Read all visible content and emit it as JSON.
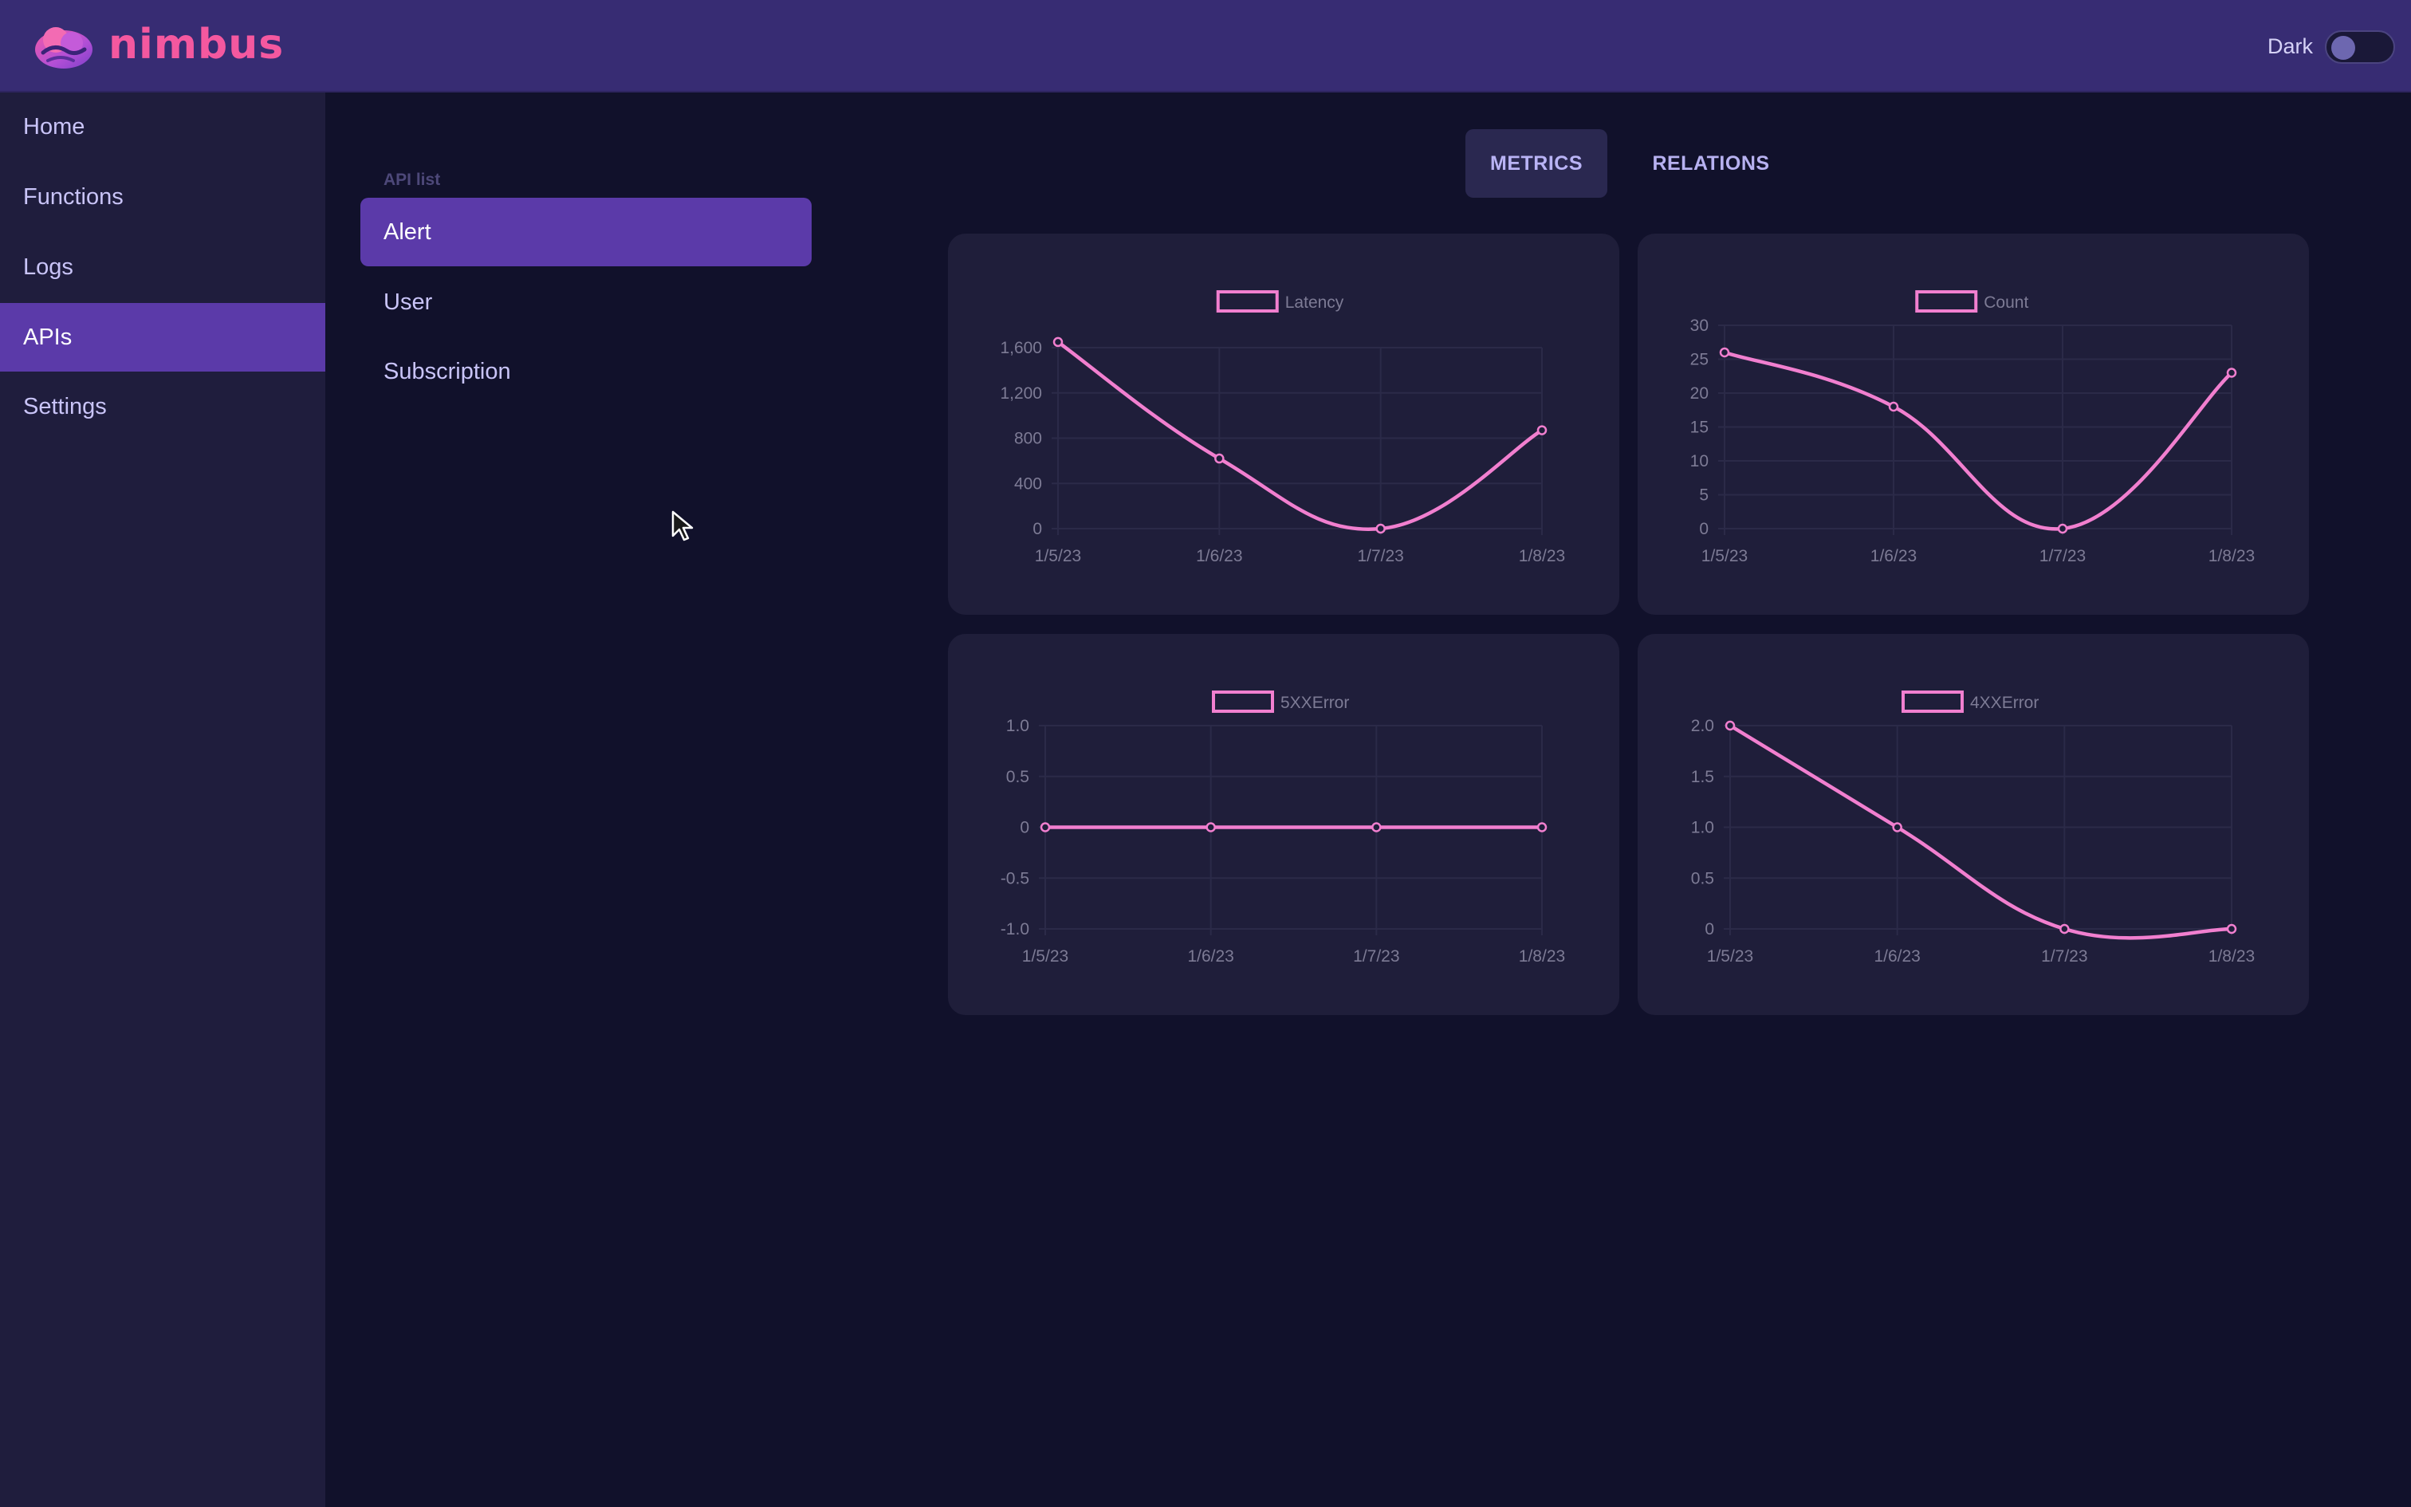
{
  "app": {
    "brand": "nimbus",
    "theme_label": "Dark",
    "theme_toggle_on": false
  },
  "sidebar": {
    "items": [
      {
        "label": "Home"
      },
      {
        "label": "Functions"
      },
      {
        "label": "Logs"
      },
      {
        "label": "APIs",
        "active": true
      },
      {
        "label": "Settings"
      }
    ]
  },
  "api_list": {
    "header": "API list",
    "items": [
      {
        "label": "Alert",
        "active": true
      },
      {
        "label": "User"
      },
      {
        "label": "Subscription"
      }
    ]
  },
  "tabs": [
    {
      "label": "METRICS",
      "active": true
    },
    {
      "label": "RELATIONS"
    }
  ],
  "colors": {
    "accent": "#5b3aa9",
    "series": "#f17fcf",
    "brand": "#f4589f",
    "grid": "#2b2a48",
    "tick": "#7d7b95"
  },
  "chart_data": [
    {
      "type": "line",
      "x": [
        "1/5/23",
        "1/6/23",
        "1/7/23",
        "1/8/23"
      ],
      "series": [
        {
          "name": "Latency",
          "values": [
            1650,
            620,
            0,
            870
          ]
        }
      ],
      "yticks": [
        "0",
        "400",
        "800",
        "1,200",
        "1,600"
      ],
      "ylim": [
        0,
        1600
      ],
      "legend": "top-center",
      "grid": true
    },
    {
      "type": "line",
      "x": [
        "1/5/23",
        "1/6/23",
        "1/7/23",
        "1/8/23"
      ],
      "series": [
        {
          "name": "Count",
          "values": [
            26,
            18,
            0,
            23
          ]
        }
      ],
      "yticks": [
        "0",
        "5",
        "10",
        "15",
        "20",
        "25",
        "30"
      ],
      "ylim": [
        0,
        30
      ],
      "legend": "top-center",
      "grid": true
    },
    {
      "type": "line",
      "x": [
        "1/5/23",
        "1/6/23",
        "1/7/23",
        "1/8/23"
      ],
      "series": [
        {
          "name": "5XXError",
          "values": [
            0,
            0,
            0,
            0
          ]
        }
      ],
      "yticks": [
        "-1.0",
        "-0.5",
        "0",
        "0.5",
        "1.0"
      ],
      "ylim": [
        -1,
        1
      ],
      "legend": "top-center",
      "grid": true
    },
    {
      "type": "line",
      "x": [
        "1/5/23",
        "1/6/23",
        "1/7/23",
        "1/8/23"
      ],
      "series": [
        {
          "name": "4XXError",
          "values": [
            2,
            1,
            0,
            0
          ]
        }
      ],
      "yticks": [
        "0",
        "0.5",
        "1.0",
        "1.5",
        "2.0"
      ],
      "ylim": [
        0,
        2
      ],
      "legend": "top-center",
      "grid": true
    }
  ]
}
